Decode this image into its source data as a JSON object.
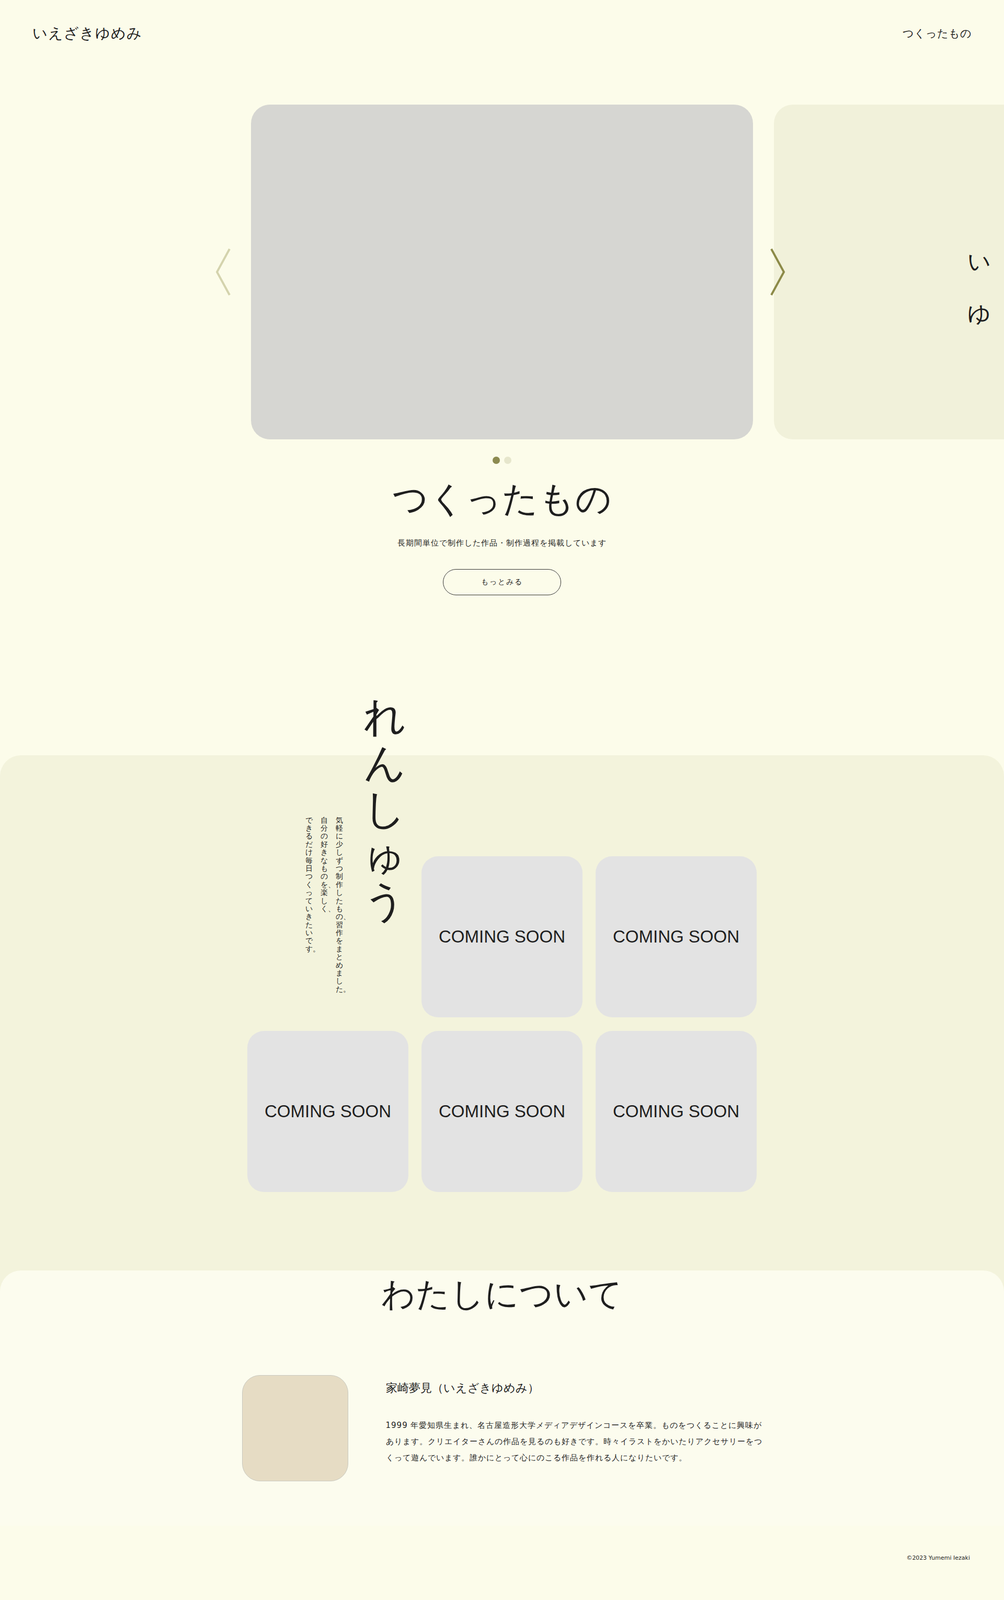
{
  "header": {
    "logo": "いえざきゆめみ",
    "nav": [
      {
        "label": "つくったもの",
        "selected": false
      }
    ]
  },
  "carousel": {
    "slides": [
      {
        "kind": "photo",
        "selected": true,
        "lines": []
      },
      {
        "kind": "text",
        "selected": false,
        "lines": [
          "い",
          "ゆ"
        ]
      }
    ],
    "prev": {
      "disabled": true
    },
    "next": {
      "disabled": false
    }
  },
  "works": {
    "title": "つくったもの",
    "description": "長期間単位で制作した作品・制作過程を掲載しています",
    "button": "もっとみる"
  },
  "practice": {
    "title": "れんしゅう",
    "description": [
      "気軽に少しずつ制作したもの、習作をまとめました。",
      "自分の好きなものを、楽しく、",
      "できるだけ毎日つくっていきたいです。"
    ],
    "cards": [
      {
        "label": "COMING SOON"
      },
      {
        "label": "COMING SOON"
      },
      {
        "label": "COMING SOON"
      },
      {
        "label": "COMING SOON"
      },
      {
        "label": "COMING SOON"
      }
    ]
  },
  "about": {
    "title": "わたしについて",
    "name": "家崎夢見（いえざきゆめみ）",
    "bio": "1999 年愛知県生まれ、名古屋造形大学メディアデザインコースを卒業。ものをつくることに興味があります。クリエイターさんの作品を見るのも好きです。時々イラストをかいたりアクセサリーをつくって遊んでいます。誰かにとって心にのこる作品を作れる人になりたいです。"
  },
  "footer": {
    "copyright": "©2023 Yumemi Iezaki"
  }
}
